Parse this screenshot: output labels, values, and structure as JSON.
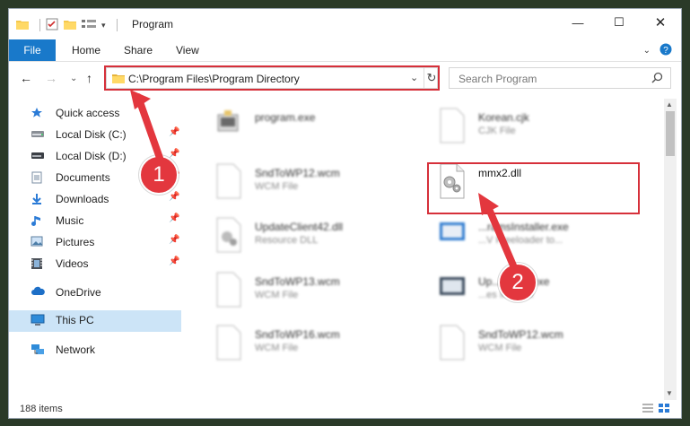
{
  "window": {
    "title": "Program"
  },
  "ribbon": {
    "tabs": [
      "File",
      "Home",
      "Share",
      "View"
    ]
  },
  "address": {
    "path": "C:\\Program Files\\Program Directory"
  },
  "search": {
    "placeholder": "Search Program"
  },
  "sidebar": {
    "items": [
      {
        "label": "Quick access",
        "icon": "star-icon",
        "pinned": false
      },
      {
        "label": "Local Disk (C:)",
        "icon": "drive-icon",
        "pinned": true
      },
      {
        "label": "Local Disk (D:)",
        "icon": "drive-icon",
        "pinned": true
      },
      {
        "label": "Documents",
        "icon": "documents-icon",
        "pinned": true
      },
      {
        "label": "Downloads",
        "icon": "download-icon",
        "pinned": true
      },
      {
        "label": "Music",
        "icon": "music-icon",
        "pinned": true
      },
      {
        "label": "Pictures",
        "icon": "pictures-icon",
        "pinned": true
      },
      {
        "label": "Videos",
        "icon": "videos-icon",
        "pinned": true
      },
      {
        "label": "OneDrive",
        "icon": "cloud-icon",
        "pinned": false
      },
      {
        "label": "This PC",
        "icon": "computer-icon",
        "pinned": false,
        "selected": true
      },
      {
        "label": "Network",
        "icon": "network-icon",
        "pinned": false
      }
    ]
  },
  "files": [
    {
      "name": "program.exe",
      "type": ""
    },
    {
      "name": "Korean.cjk",
      "type": "CJK File"
    },
    {
      "name": "SndToWP12.wcm",
      "type": "WCM File"
    },
    {
      "name": "mmx2.dll",
      "type": ""
    },
    {
      "name": "UpdateClient42.dll",
      "type": "Resource DLL"
    },
    {
      "name": "...ramsInstaller.exe",
      "type": "...V Freeloader to..."
    },
    {
      "name": "SndToWP13.wcm",
      "type": "WCM File"
    },
    {
      "name": "Up...staller.exe",
      "type": "...es Installer"
    },
    {
      "name": "SndToWP16.wcm",
      "type": "WCM File"
    },
    {
      "name": "SndToWP12.wcm",
      "type": "WCM File"
    }
  ],
  "status": {
    "item_count": "188 items"
  },
  "annotations": {
    "step1": "1",
    "step2": "2"
  },
  "colors": {
    "accent": "#1979ca",
    "highlight": "#d6303a",
    "badge": "#e3373e",
    "selected": "#cce4f7"
  }
}
